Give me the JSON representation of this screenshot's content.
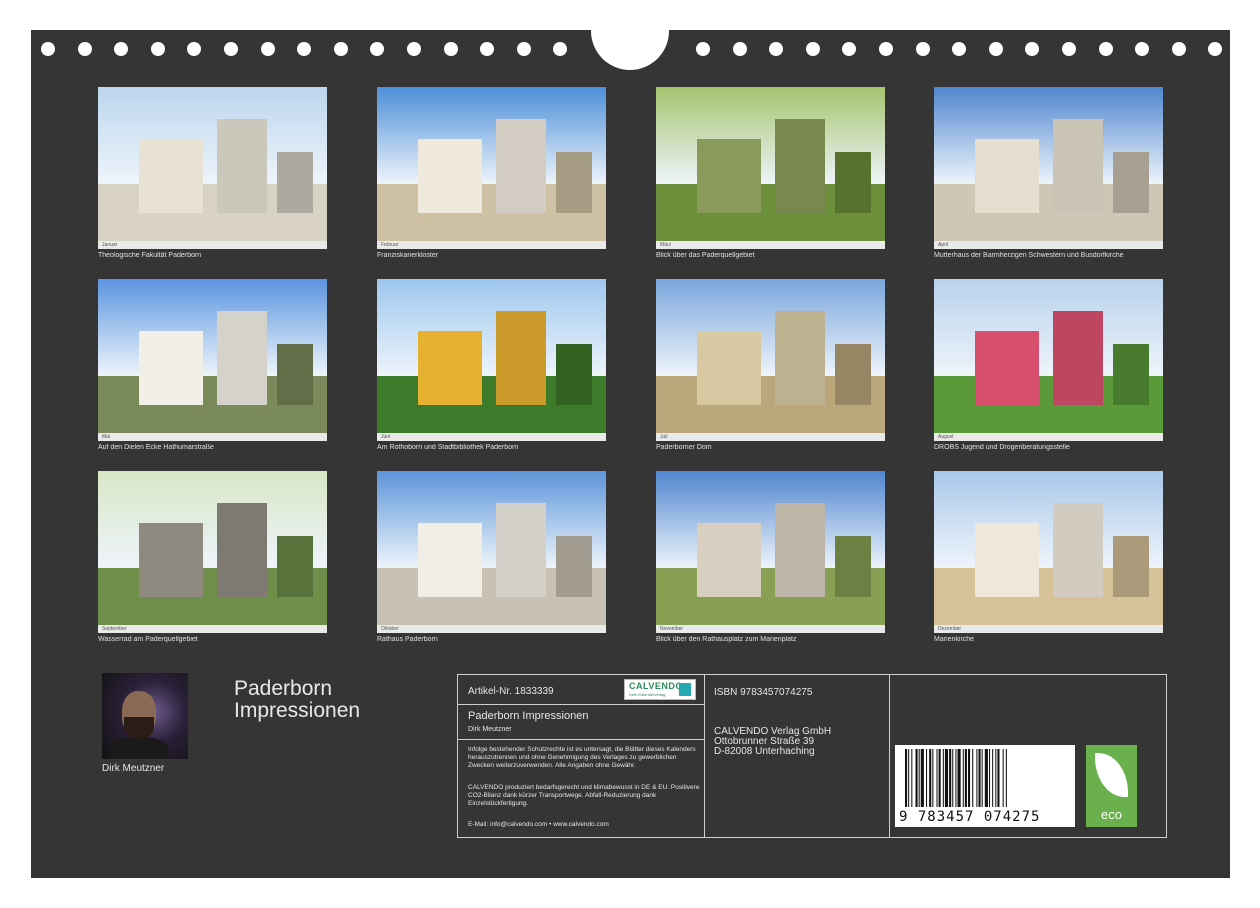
{
  "calendar": {
    "title_line1": "Paderborn",
    "title_line2": "Impressionen",
    "author": "Dirk Meutzner"
  },
  "photos": [
    {
      "caption": "Theologische Fakultät Paderborn",
      "month": "Januar"
    },
    {
      "caption": "Franziskanerkloster",
      "month": "Februar"
    },
    {
      "caption": "Blick über das Paderquellgebiet",
      "month": "März"
    },
    {
      "caption": "Mutterhaus der Barmherzigen Schwestern und Busdorfkirche",
      "month": "April"
    },
    {
      "caption": "Auf den Dielen Ecke Hathumarstraße",
      "month": "Mai"
    },
    {
      "caption": "Am Rothoborn und Stadtbibliothek Paderborn",
      "month": "Juni"
    },
    {
      "caption": "Paderborner Dom",
      "month": "Juli"
    },
    {
      "caption": "DROBS Jugend und Drogenberatungsstelle",
      "month": "August"
    },
    {
      "caption": "Wasserrad am Paderquellgebiet",
      "month": "September"
    },
    {
      "caption": "Rathaus Paderborn",
      "month": "Oktober"
    },
    {
      "caption": "Blick über den Rathausplatz zum Marienplatz",
      "month": "November"
    },
    {
      "caption": "Marienkirche",
      "month": "Dezember"
    }
  ],
  "info": {
    "article": "Artikel-Nr. 1833339",
    "logo_name": "CALVENDO",
    "logo_sub": "Dein Kalenderverlag",
    "title": "Paderborn Impressionen",
    "author": "Dirk Meutzner",
    "legal_1": "Infolge bestehender Schutzrechte ist es untersagt, die Blätter dieses Kalenders herauszutrennen und ohne Genehmigung des Verlages zu gewerblichen Zwecken weiterzuverwenden. Alle Angaben ohne Gewähr.",
    "legal_2": "CALVENDO produziert bedarfsgerecht und klimabewusst in DE & EU. Positivere CO2-Bilanz dank kürzer Transportwege. Abfall-Reduzierung dank Einzelstückfertigung.",
    "contact": "E-Mail: info@calvendo.com • www.calvendo.com",
    "isbn": "ISBN 9783457074275",
    "publisher_1": "CALVENDO Verlag GmbH",
    "publisher_2": "Ottobrunner Straße 39",
    "publisher_3": "D-82008 Unterhaching",
    "barcode_number": "9 783457 074275",
    "eco_label": "eco"
  },
  "colors": {
    "background": "#353535",
    "text": "#e6e6e6",
    "eco_green": "#6ab04c",
    "calvendo_green": "#2a8a57"
  }
}
